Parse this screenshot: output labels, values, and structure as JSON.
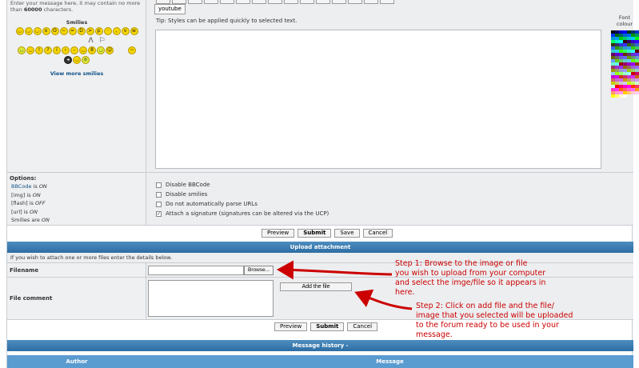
{
  "message_area": {
    "note_prefix": "Enter your message here, it may contain no more than",
    "note_limit": "60000",
    "note_suffix": "characters.",
    "tip": "Tip: Styles can be applied quickly to selected text.",
    "youtube_button": "youtube",
    "font_colour_label": "Font colour"
  },
  "smilies": {
    "title": "Smilies",
    "view_more": "View more smilies"
  },
  "options": {
    "title": "Options:",
    "bbcode_label": "BBCode",
    "bbcode_state": "ON",
    "img_label": "[img]",
    "img_state": "ON",
    "flash_label": "[flash]",
    "flash_state": "OFF",
    "url_label": "[url]",
    "url_state": "ON",
    "smilies_label": "Smilies are",
    "smilies_state": "ON",
    "is_word": "is",
    "checkboxes": [
      {
        "label": "Disable BBCode",
        "checked": false
      },
      {
        "label": "Disable smilies",
        "checked": false
      },
      {
        "label": "Do not automatically parse URLs",
        "checked": false
      },
      {
        "label": "Attach a signature (signatures can be altered via the UCP)",
        "checked": true
      }
    ]
  },
  "actions": {
    "preview": "Preview",
    "submit": "Submit",
    "save": "Save",
    "cancel": "Cancel"
  },
  "attachment": {
    "bar_title": "Upload attachment",
    "intro": "If you wish to attach one or more files enter the details below.",
    "filename_label": "Filename",
    "browse_button": "Browse...",
    "comment_label": "File comment",
    "add_file_button": "Add the file"
  },
  "annotations": {
    "step1": [
      "Step 1: Browse to the image or file",
      "you wish to upload from your computer",
      "and select the imge/file so it appears in",
      "here."
    ],
    "step2": [
      "Step 2: Click on add file and the file/",
      "image that you selected will be uploaded",
      "to the forum ready to be used in your",
      "message."
    ],
    "color": "#cc0000"
  },
  "history": {
    "bar_title": "Message history -",
    "author_col": "Author",
    "message_col": "Message"
  },
  "colors": {
    "bar_blue": "#2d6da3",
    "link_blue": "#105289",
    "panel_grey": "#eceef0"
  }
}
